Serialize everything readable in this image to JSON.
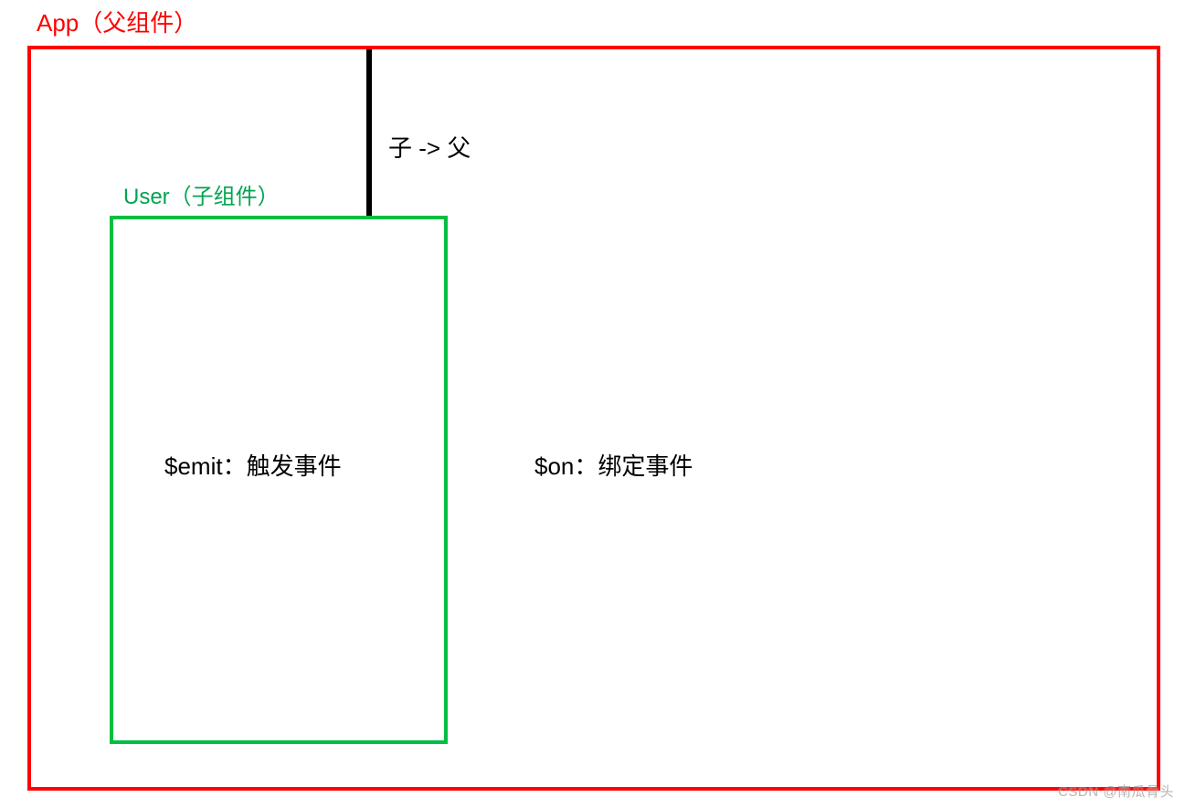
{
  "parent": {
    "label": "App（父组件）"
  },
  "child": {
    "label": "User（子组件）"
  },
  "arrow": {
    "label": "子 -> 父"
  },
  "inner": {
    "emit": "$emit：触发事件",
    "on": "$on：绑定事件"
  },
  "watermark": "CSDN @南瓜骨头",
  "colors": {
    "parent_border": "#ff0000",
    "child_border": "#00c040",
    "arrow": "#000000",
    "text": "#000000"
  }
}
